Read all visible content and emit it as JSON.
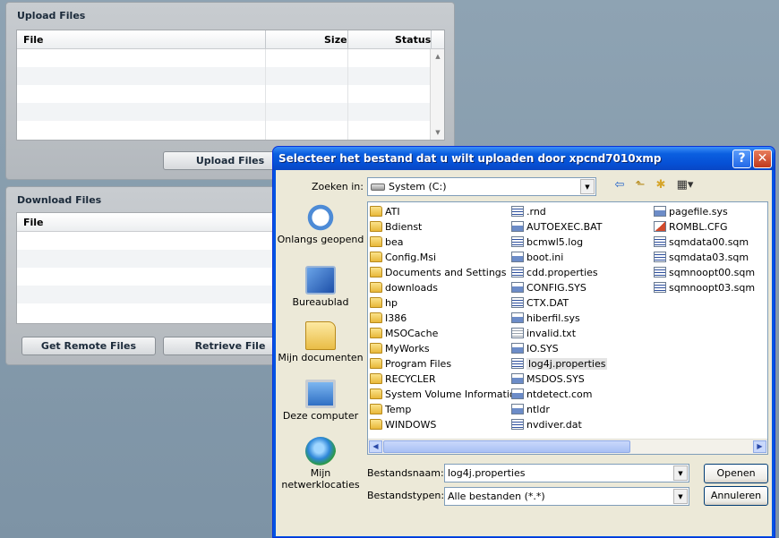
{
  "upload_panel": {
    "title": "Upload Files",
    "columns": [
      "File",
      "Size",
      "Status"
    ],
    "upload_button": "Upload Files"
  },
  "download_panel": {
    "title": "Download Files",
    "columns": [
      "File"
    ],
    "get_remote_button": "Get Remote Files",
    "retrieve_button": "Retrieve File"
  },
  "dialog": {
    "title": "Selecteer het bestand dat u wilt uploaden door xpcnd7010xmp",
    "help_glyph": "?",
    "close_glyph": "✕",
    "look_in_label": "Zoeken in:",
    "look_in_value": "System (C:)",
    "places": [
      {
        "label": "Onlangs geopend",
        "icon": "recent-icon"
      },
      {
        "label": "Bureaublad",
        "icon": "desktop-icon"
      },
      {
        "label": "Mijn documenten",
        "icon": "my-documents-icon"
      },
      {
        "label": "Deze computer",
        "icon": "my-computer-icon"
      },
      {
        "label": "Mijn netwerklocaties",
        "icon": "network-places-icon"
      }
    ],
    "files_col1": [
      {
        "name": "ATI",
        "type": "folder"
      },
      {
        "name": "Bdienst",
        "type": "folder"
      },
      {
        "name": "bea",
        "type": "folder"
      },
      {
        "name": "Config.Msi",
        "type": "folder"
      },
      {
        "name": "Documents and Settings",
        "type": "folder"
      },
      {
        "name": "downloads",
        "type": "folder"
      },
      {
        "name": "hp",
        "type": "folder"
      },
      {
        "name": "I386",
        "type": "folder"
      },
      {
        "name": "MSOCache",
        "type": "folder"
      },
      {
        "name": "MyWorks",
        "type": "folder"
      },
      {
        "name": "Program Files",
        "type": "folder"
      },
      {
        "name": "RECYCLER",
        "type": "folder"
      },
      {
        "name": "System Volume Information",
        "type": "folder"
      },
      {
        "name": "Temp",
        "type": "folder"
      },
      {
        "name": "WINDOWS",
        "type": "folder"
      }
    ],
    "files_col2": [
      {
        "name": ".rnd",
        "type": "dat"
      },
      {
        "name": "AUTOEXEC.BAT",
        "type": "sys"
      },
      {
        "name": "bcmwl5.log",
        "type": "dat"
      },
      {
        "name": "boot.ini",
        "type": "sys"
      },
      {
        "name": "cdd.properties",
        "type": "dat"
      },
      {
        "name": "CONFIG.SYS",
        "type": "sys"
      },
      {
        "name": "CTX.DAT",
        "type": "dat"
      },
      {
        "name": "hiberfil.sys",
        "type": "sys"
      },
      {
        "name": "invalid.txt",
        "type": "txt"
      },
      {
        "name": "IO.SYS",
        "type": "sys"
      },
      {
        "name": "log4j.properties",
        "type": "dat",
        "selected": true
      },
      {
        "name": "MSDOS.SYS",
        "type": "sys"
      },
      {
        "name": "ntdetect.com",
        "type": "sys"
      },
      {
        "name": "ntldr",
        "type": "sys"
      },
      {
        "name": "nvdiver.dat",
        "type": "dat"
      }
    ],
    "files_col3": [
      {
        "name": "pagefile.sys",
        "type": "sys"
      },
      {
        "name": "ROMBL.CFG",
        "type": "cfg"
      },
      {
        "name": "sqmdata00.sqm",
        "type": "dat"
      },
      {
        "name": "sqmdata03.sqm",
        "type": "dat"
      },
      {
        "name": "sqmnoopt00.sqm",
        "type": "dat"
      },
      {
        "name": "sqmnoopt03.sqm",
        "type": "dat"
      }
    ],
    "filename_label": "Bestandsnaam:",
    "filename_value": "log4j.properties",
    "filetype_label": "Bestandstypen:",
    "filetype_value": "Alle bestanden (*.*)",
    "open_button": "Openen",
    "cancel_button": "Annuleren"
  }
}
